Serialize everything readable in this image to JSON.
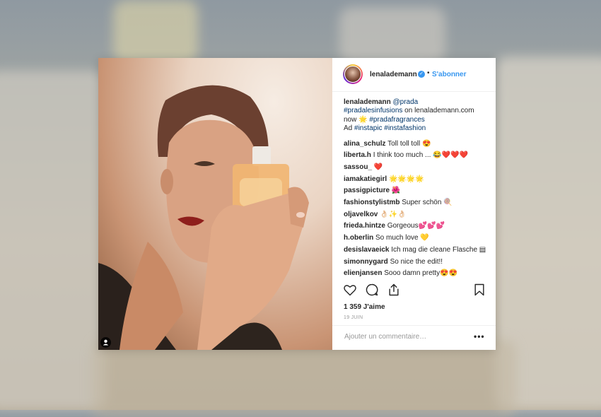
{
  "post": {
    "username": "lenalademann",
    "verified": true,
    "follow_label": "S'abonner",
    "caption": {
      "username": "lenalademann",
      "mention": "@prada",
      "hashtag1": "#pradalesinfusions",
      "text1": "on lenalademann.com now",
      "emoji1": "🌟",
      "hashtag2": "#pradafragrances",
      "ad_label": "Ad",
      "hashtag3": "#instapic",
      "hashtag4": "#instafashion"
    },
    "comments": [
      {
        "user": "alina_schulz",
        "text": "Toll toll toll 😍"
      },
      {
        "user": "liberta.h",
        "text": "I think too much ... 😂❤️❤️❤️"
      },
      {
        "user": "sassou_",
        "text": "❤️"
      },
      {
        "user": "iamakatiegirl",
        "text": "🌟🌟🌟🌟"
      },
      {
        "user": "passigpicture",
        "text": "🌺"
      },
      {
        "user": "fashionstylistmb",
        "text": "Super schön 🍭"
      },
      {
        "user": "oljavelkov",
        "text": "👌🏻✨👌🏻"
      },
      {
        "user": "frieda.hintze",
        "text": "Gorgeous💕💕💕"
      },
      {
        "user": "h.oberlin",
        "text": "So much love 💛"
      },
      {
        "user": "desislavaeick",
        "text": "Ich mag die cleane Flasche ▤"
      },
      {
        "user": "simonnygard",
        "text": "So nice the edit!!"
      },
      {
        "user": "elienjansen",
        "text": "Sooo damn pretty😍😍"
      }
    ],
    "likes": "1 359 J'aime",
    "date": "19 JUIN",
    "add_comment_placeholder": "Ajouter un commentaire…",
    "more_label": "•••"
  },
  "icons": {
    "heart": "heart-icon",
    "comment": "comment-icon",
    "share": "share-icon",
    "bookmark": "bookmark-icon",
    "verified": "verified-badge-icon",
    "user_tag": "user-tag-icon"
  },
  "colors": {
    "link": "#3897f0",
    "hashtag": "#003569",
    "text": "#262626",
    "muted": "#999999"
  }
}
